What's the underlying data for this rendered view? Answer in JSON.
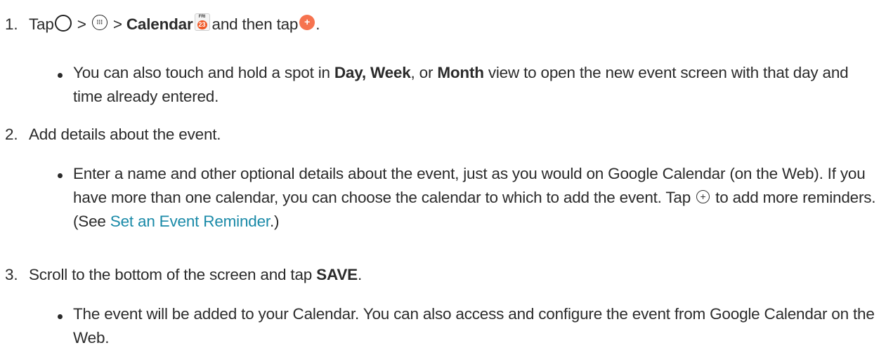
{
  "steps": [
    {
      "number": "1.",
      "parts": {
        "tap": "Tap",
        "gt1": ">",
        "gt2": ">",
        "calendar": "Calendar",
        "and_then_tap": "and then tap",
        "period": "."
      },
      "icons": {
        "home": "home-button-icon",
        "apps": "apps-icon",
        "calendar": "calendar-app-icon",
        "add_event": "add-event-fab-icon"
      },
      "calendar_icon": {
        "day": "FRI",
        "date": "23"
      },
      "bullet": {
        "t1": "You can also touch and hold a spot in ",
        "day_week": "Day, Week",
        "t2": ", or ",
        "month": "Month",
        "t3": " view to open the new event screen with that day and time already entered."
      }
    },
    {
      "number": "2.",
      "text": "Add details about the event.",
      "bullet": {
        "t1": "Enter a name and other optional details about the event, just as you would on Google Calendar (on the Web). If you have more than one calendar, you can choose the calendar to which to add the event. Tap ",
        "t2": " to add more reminders. (See ",
        "link": "Set an Event Reminder",
        "t3": ".)"
      },
      "icons": {
        "add": "add-reminder-icon"
      }
    },
    {
      "number": "3.",
      "parts": {
        "t1": "Scroll to the bottom of the screen and tap ",
        "save": "SAVE",
        "t2": "."
      },
      "bullet": {
        "text": "The event will be added to your Calendar. You can also access and configure the event from Google Calendar on the Web."
      }
    }
  ],
  "colors": {
    "text": "#2b2b2b",
    "link": "#1a8aa8",
    "accent": "#f6734f"
  }
}
